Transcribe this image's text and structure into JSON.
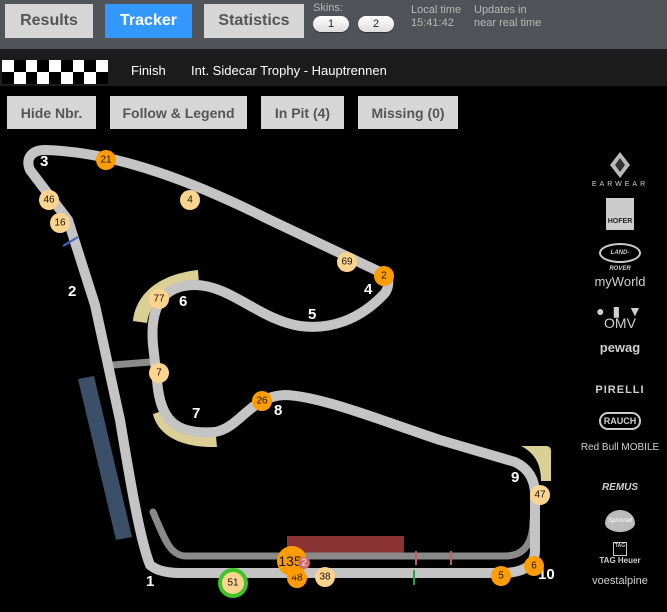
{
  "nav": {
    "tabs": [
      {
        "label": "Results",
        "active": false
      },
      {
        "label": "Tracker",
        "active": true
      },
      {
        "label": "Statistics",
        "active": false
      }
    ],
    "skins_label": "Skins:",
    "skins": [
      "1",
      "2"
    ],
    "local_time_label": "Local time",
    "local_time": "15:41:42",
    "updates_line1": "Updates in",
    "updates_line2": "near real time"
  },
  "status": {
    "flag": "checkered-flag",
    "state": "Finish",
    "race_name": "Int. Sidecar Trophy - Hauptrennen"
  },
  "controls": {
    "hide_numbers": "Hide Nbr.",
    "follow_legend": "Follow & Legend",
    "in_pit": "In Pit (4)",
    "missing": "Missing (0)"
  },
  "colors": {
    "tab_active": "#3399ff",
    "track": "#c4c4c4",
    "pitlane": "#8a8a8a",
    "car_light": "#fdd48e",
    "car_orange": "#ff9c00",
    "car_highlight_ring": "#3fc42a",
    "badge_red": "#d66a6a",
    "runoff": "#dccf93",
    "grandstand": "#3b5068",
    "pit_building": "#8b3232"
  },
  "track": {
    "corners": [
      "1",
      "2",
      "3",
      "4",
      "5",
      "6",
      "7",
      "7",
      "8",
      "9",
      "10"
    ],
    "cars": [
      {
        "number": "21",
        "style": "orange"
      },
      {
        "number": "4",
        "style": "light"
      },
      {
        "number": "46",
        "style": "light"
      },
      {
        "number": "16",
        "style": "light"
      },
      {
        "number": "69",
        "style": "light"
      },
      {
        "number": "2",
        "style": "orange"
      },
      {
        "number": "77",
        "style": "light"
      },
      {
        "number": "7",
        "style": "light"
      },
      {
        "number": "26",
        "style": "orange"
      },
      {
        "number": "47",
        "style": "light"
      },
      {
        "number": "6",
        "style": "orange"
      },
      {
        "number": "5",
        "style": "orange"
      },
      {
        "number": "38",
        "style": "light"
      },
      {
        "number": "48",
        "style": "orange"
      },
      {
        "number": "51",
        "style": "light",
        "followed": true
      },
      {
        "number": "135",
        "style": "orange",
        "badge": "2"
      }
    ]
  },
  "sponsors": [
    "EARWEAR",
    "HOFER",
    "LAND-ROVER",
    "myWorld",
    "OMV",
    "pewag",
    "PIRELLI",
    "RAUCH",
    "Red Bull MOBILE",
    "REMUS",
    "Spinnrad",
    "TAG Heuer",
    "voestalpine"
  ]
}
